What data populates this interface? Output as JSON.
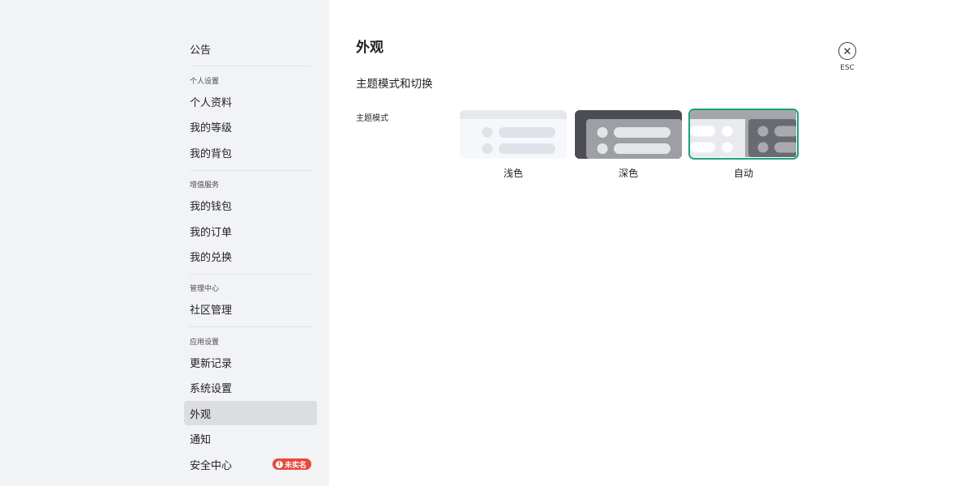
{
  "sidebar": {
    "announcement": "公告",
    "groups": [
      {
        "header": "个人设置",
        "items": [
          "个人资料",
          "我的等级",
          "我的背包"
        ]
      },
      {
        "header": "增值服务",
        "items": [
          "我的钱包",
          "我的订单",
          "我的兑换"
        ]
      },
      {
        "header": "管理中心",
        "items": [
          "社区管理"
        ]
      },
      {
        "header": "应用设置",
        "items": [
          "更新记录",
          "系统设置",
          "外观",
          "通知",
          "安全中心"
        ]
      }
    ],
    "active_item": "外观",
    "security_badge": "未实名",
    "badge_icon": "!"
  },
  "main": {
    "page_title": "外观",
    "section_title": "主题模式和切换",
    "field_label": "主题模式",
    "themes": [
      {
        "label": "浅色",
        "selected": false
      },
      {
        "label": "深色",
        "selected": false
      },
      {
        "label": "自动",
        "selected": true
      }
    ],
    "close_label": "ESC",
    "accent_color": "#1aa37a"
  }
}
